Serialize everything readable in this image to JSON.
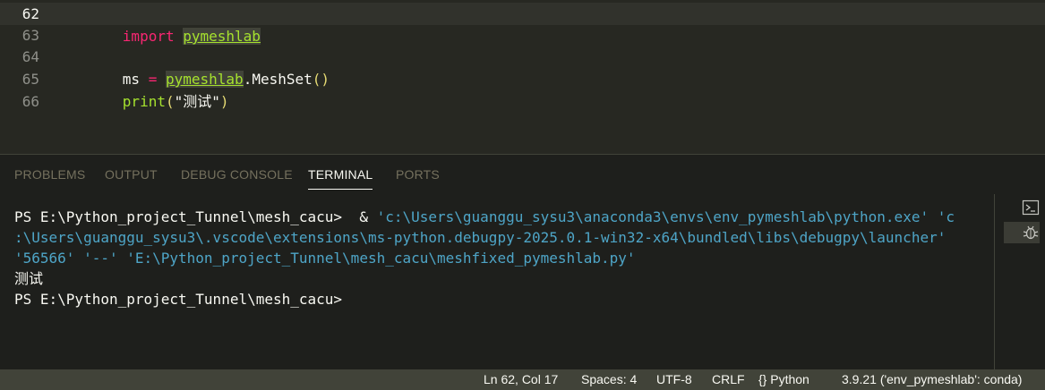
{
  "editor": {
    "lines": [
      {
        "number": "62",
        "current": true
      },
      {
        "number": "63"
      },
      {
        "number": "64"
      },
      {
        "number": "65"
      },
      {
        "number": "66"
      }
    ],
    "tokens": {
      "l62_import": "import",
      "l62_module": "pymeshlab",
      "l64_var": "ms",
      "l64_eq": "=",
      "l64_module": "pymeshlab",
      "l64_call": ".MeshSet",
      "l64_parens": "()",
      "l65_fn": "print",
      "l65_open": "(",
      "l65_str": "\"测试\"",
      "l65_close": ")"
    }
  },
  "panel": {
    "tabs": [
      "PROBLEMS",
      "OUTPUT",
      "DEBUG CONSOLE",
      "TERMINAL",
      "PORTS"
    ],
    "active_tab": "TERMINAL",
    "terminal": {
      "line1_prompt": "PS E:\\Python_project_Tunnel\\mesh_cacu>",
      "line1_amp": "  &",
      "line1_args": " 'c:\\Users\\guanggu_sysu3\\anaconda3\\envs\\env_pymeshlab\\python.exe' 'c",
      "line2": ":\\Users\\guanggu_sysu3\\.vscode\\extensions\\ms-python.debugpy-2025.0.1-win32-x64\\bundled\\libs\\debugpy\\launcher'",
      "line3": "'56566' '--' 'E:\\Python_project_Tunnel\\mesh_cacu\\meshfixed_pymeshlab.py'",
      "line4": "测试",
      "line5": "PS E:\\Python_project_Tunnel\\mesh_cacu>"
    },
    "side_icons": [
      "terminal-icon",
      "debug-icon"
    ]
  },
  "statusbar": {
    "position": "Ln 62, Col 17",
    "spaces": "Spaces: 4",
    "encoding": "UTF-8",
    "eol": "CRLF",
    "language_braces": "{}",
    "language": "Python",
    "interpreter": "3.9.21 ('env_pymeshlab': conda)"
  },
  "colors": {
    "editor_bg": "#272822",
    "panel_bg": "#1e1f1c",
    "statusbar_bg": "#414339",
    "keyword": "#f92672",
    "function": "#a6e22e",
    "string": "#e6db74",
    "terminal_string": "#4ea5c7"
  }
}
